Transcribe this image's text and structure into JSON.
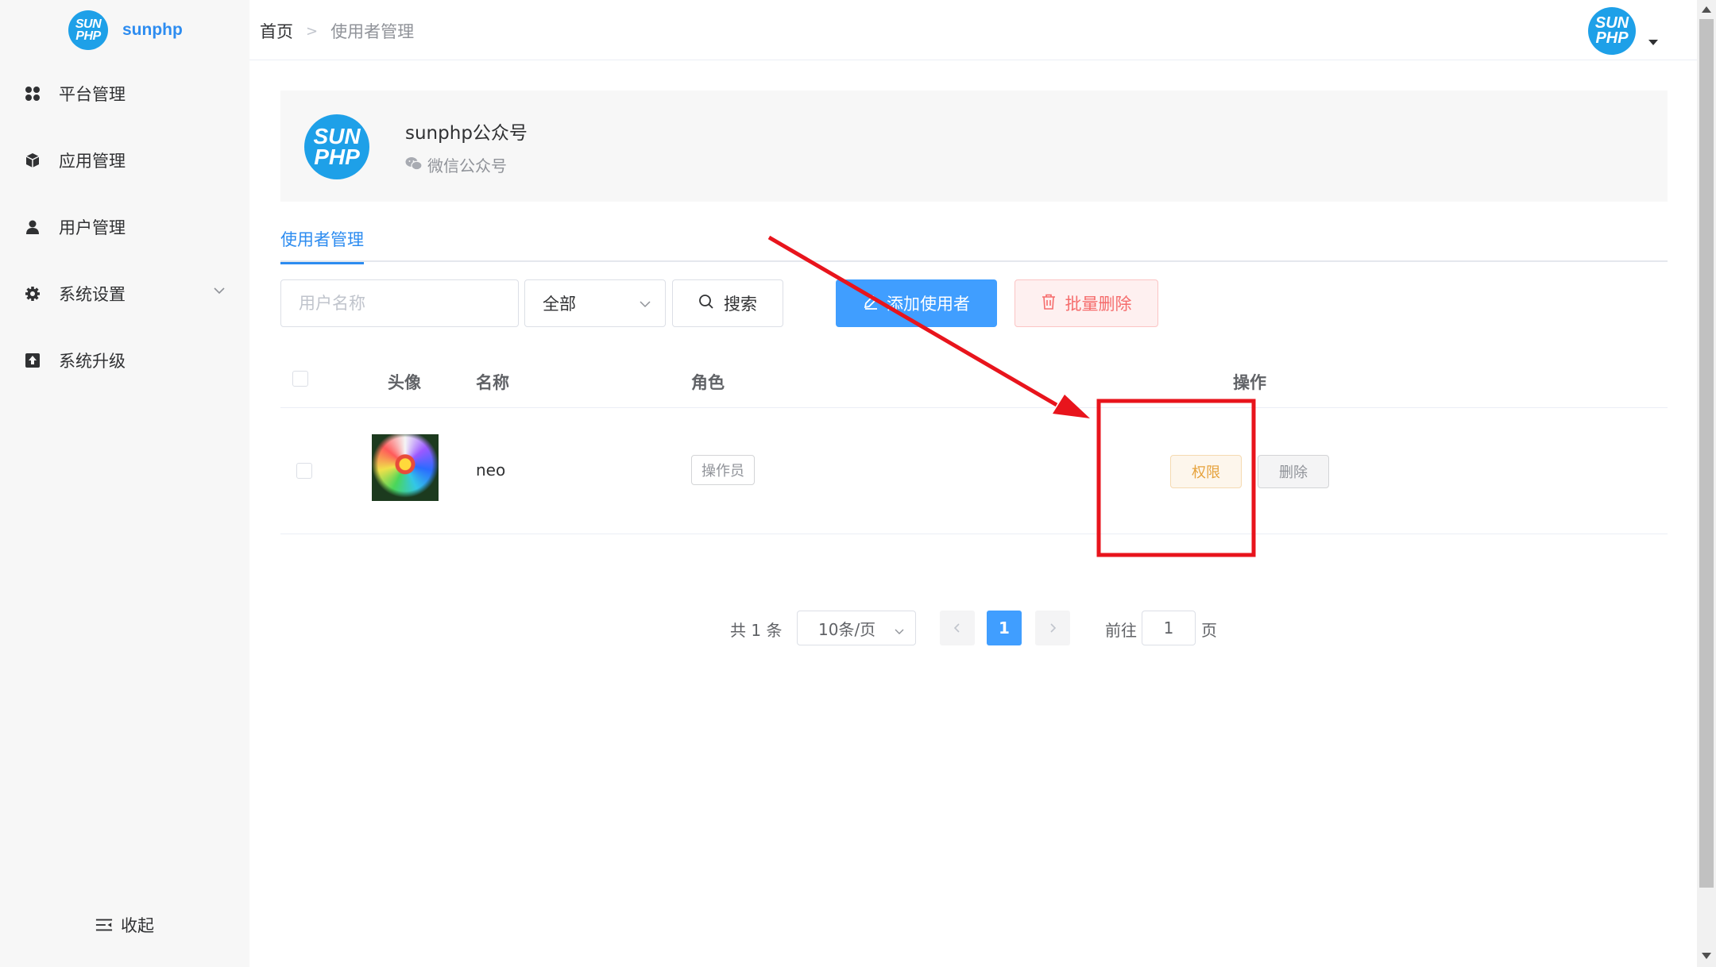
{
  "sidebar": {
    "brand": {
      "logo_text_top": "SUN",
      "logo_text_bottom": "PHP",
      "name": "sunphp"
    },
    "items": [
      {
        "label": "平台管理",
        "icon": "apps-icon"
      },
      {
        "label": "应用管理",
        "icon": "cube-icon"
      },
      {
        "label": "用户管理",
        "icon": "user-icon"
      },
      {
        "label": "系统设置",
        "icon": "gear-icon"
      },
      {
        "label": "系统升级",
        "icon": "upload-icon"
      }
    ],
    "collapse_label": "收起"
  },
  "header": {
    "breadcrumb": {
      "home": "首页",
      "separator": ">",
      "current": "使用者管理"
    },
    "avatar_text_top": "SUN",
    "avatar_text_bottom": "PHP"
  },
  "account": {
    "logo_text_top": "SUN",
    "logo_text_bottom": "PHP",
    "name": "sunphp公众号",
    "type": "微信公众号"
  },
  "tabs": [
    {
      "label": "使用者管理",
      "active": true
    }
  ],
  "toolbar": {
    "username_placeholder": "用户名称",
    "role_select_value": "全部",
    "search_label": "搜索",
    "add_label": "添加使用者",
    "batch_delete_label": "批量删除"
  },
  "table": {
    "columns": {
      "avatar": "头像",
      "name": "名称",
      "role": "角色",
      "actions": "操作"
    },
    "rows": [
      {
        "name": "neo",
        "role": "操作员",
        "permission_label": "权限",
        "delete_label": "删除"
      }
    ]
  },
  "pagination": {
    "total_text": "共 1 条",
    "page_size": "10条/页",
    "current_page": "1",
    "goto_prefix": "前往",
    "goto_value": "1",
    "goto_suffix": "页"
  },
  "colors": {
    "primary": "#409eff",
    "brand_blue": "#1ea0e8",
    "danger": "#f56c6c",
    "warning": "#e6a23c",
    "annotation_red": "#e8141c"
  }
}
